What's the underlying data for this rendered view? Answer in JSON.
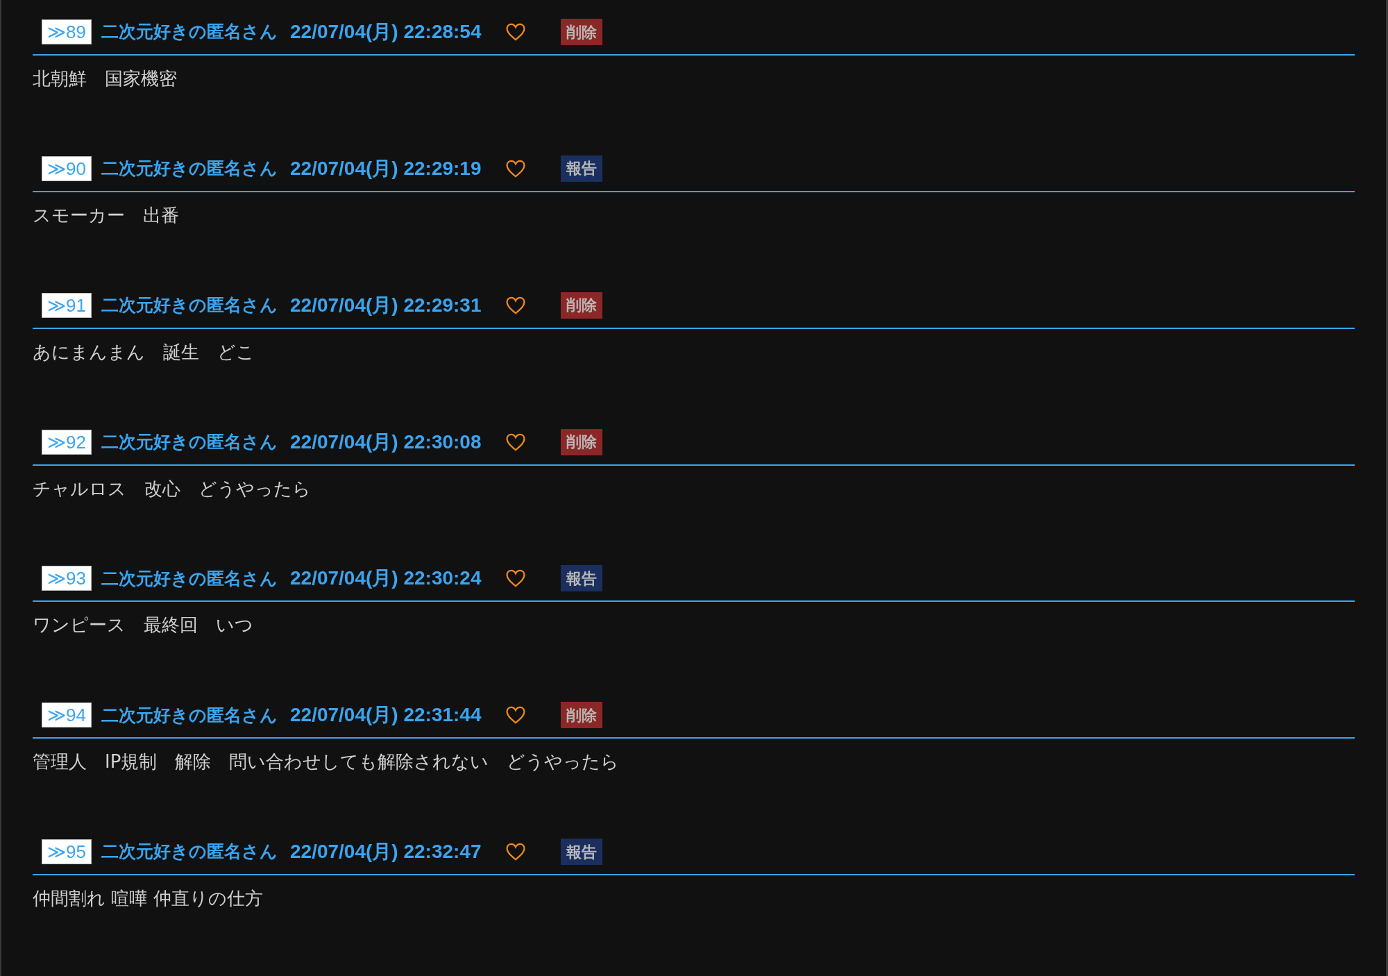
{
  "posts": [
    {
      "number": "≫89",
      "author": "二次元好きの匿名さん",
      "date": "22/07/04(月) 22:28:54",
      "action": {
        "kind": "delete",
        "label": "削除"
      },
      "body": "北朝鮮　国家機密"
    },
    {
      "number": "≫90",
      "author": "二次元好きの匿名さん",
      "date": "22/07/04(月) 22:29:19",
      "action": {
        "kind": "report",
        "label": "報告"
      },
      "body": "スモーカー　出番"
    },
    {
      "number": "≫91",
      "author": "二次元好きの匿名さん",
      "date": "22/07/04(月) 22:29:31",
      "action": {
        "kind": "delete",
        "label": "削除"
      },
      "body": "あにまんまん　誕生　どこ"
    },
    {
      "number": "≫92",
      "author": "二次元好きの匿名さん",
      "date": "22/07/04(月) 22:30:08",
      "action": {
        "kind": "delete",
        "label": "削除"
      },
      "body": "チャルロス　改心　どうやったら"
    },
    {
      "number": "≫93",
      "author": "二次元好きの匿名さん",
      "date": "22/07/04(月) 22:30:24",
      "action": {
        "kind": "report",
        "label": "報告"
      },
      "body": "ワンピース　最終回　いつ"
    },
    {
      "number": "≫94",
      "author": "二次元好きの匿名さん",
      "date": "22/07/04(月) 22:31:44",
      "action": {
        "kind": "delete",
        "label": "削除"
      },
      "body": "管理人　IP規制　解除　問い合わせしても解除されない　どうやったら"
    },
    {
      "number": "≫95",
      "author": "二次元好きの匿名さん",
      "date": "22/07/04(月) 22:32:47",
      "action": {
        "kind": "report",
        "label": "報告"
      },
      "body": "仲間割れ 喧嘩 仲直りの仕方"
    }
  ]
}
